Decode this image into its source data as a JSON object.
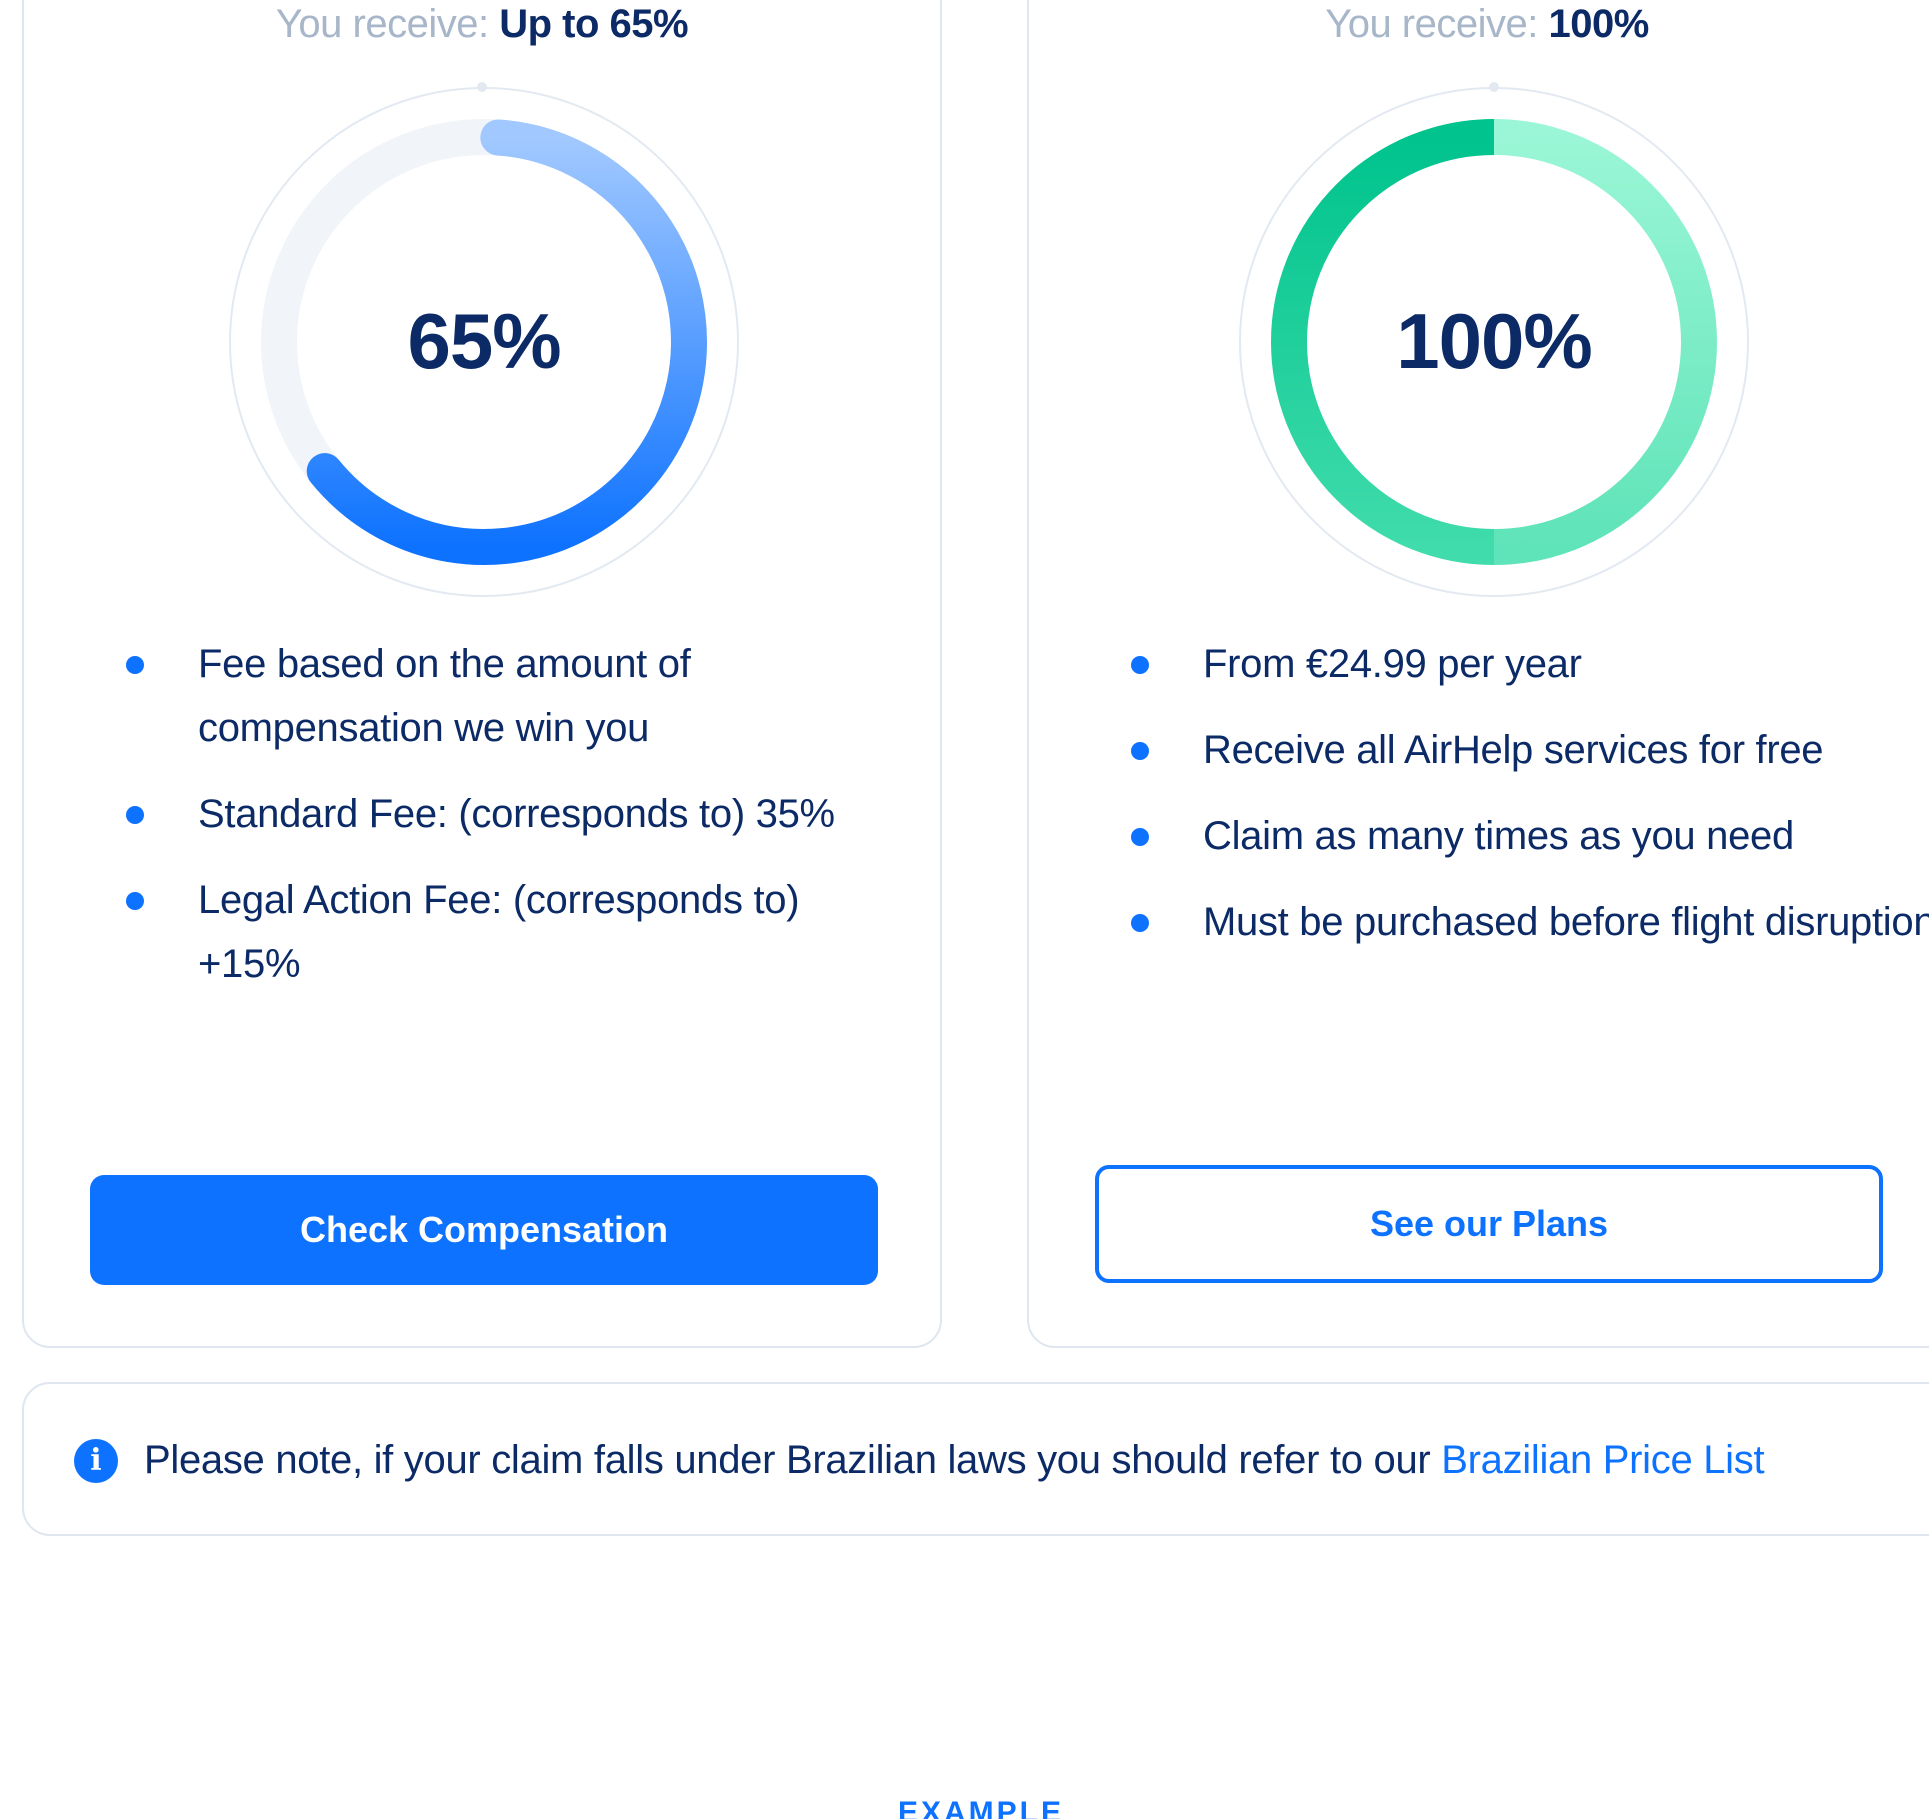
{
  "cards": [
    {
      "receive_prefix": "You receive: ",
      "receive_value": "Up to 65%",
      "gauge": {
        "value_percent": 65,
        "label": "65%",
        "color_start": "#a2c9ff",
        "color_end": "#0d72ff",
        "track_color": "#f1f4f8"
      },
      "bullets": [
        "Fee based on the amount of compensation we win you",
        "Standard Fee: (corresponds to) 35%",
        "Legal Action Fee: (corresponds to) +15%"
      ],
      "button_label": "Check Compensation"
    },
    {
      "receive_prefix": "You receive: ",
      "receive_value": "100%",
      "gauge": {
        "value_percent": 100,
        "label": "100%",
        "color_start": "#00c38d",
        "color_end": "#8ff5d2",
        "track_color": "#f1f4f8"
      },
      "bullets": [
        "From €24.99 per year",
        "Receive all AirHelp services for free",
        "Claim as many times as you need",
        "Must be purchased before flight disruption"
      ],
      "button_label": "See our Plans"
    }
  ],
  "note": {
    "text": "Please note, if your claim falls under Brazilian laws you should refer to our ",
    "link_label": "Brazilian Price List"
  },
  "section_label": "EXAMPLE",
  "colors": {
    "accent": "#0d72ff",
    "text": "#0b2a66",
    "muted": "#a7b6c8",
    "border": "#dfe6ef"
  }
}
